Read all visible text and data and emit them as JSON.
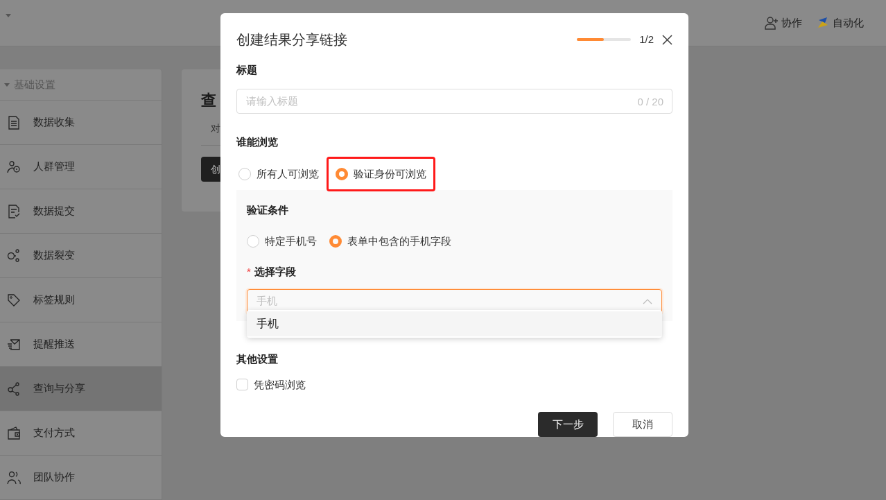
{
  "header": {
    "actions": [
      {
        "kind": "collab",
        "label": "协作"
      },
      {
        "kind": "automation",
        "label": "自动化"
      }
    ]
  },
  "sidebar": {
    "group": {
      "label": "基础设置",
      "expanded": true
    },
    "items": [
      {
        "kind": "doc",
        "label": "数据收集",
        "selected": false
      },
      {
        "kind": "people",
        "label": "人群管理",
        "selected": false
      },
      {
        "kind": "submit",
        "label": "数据提交",
        "selected": false
      },
      {
        "kind": "fission",
        "label": "数据裂变",
        "selected": false
      },
      {
        "kind": "tag",
        "label": "标签规则",
        "selected": false
      },
      {
        "kind": "mail",
        "label": "提醒推送",
        "selected": false
      },
      {
        "kind": "share",
        "label": "查询与分享",
        "selected": true
      },
      {
        "kind": "wallet",
        "label": "支付方式",
        "selected": false
      },
      {
        "kind": "team",
        "label": "团队协作",
        "selected": false
      }
    ]
  },
  "page": {
    "title": "查",
    "tab": "对",
    "button": "创"
  },
  "dialog": {
    "title": "创建结果分享链接",
    "progress": {
      "level": 0.5,
      "text": "1/2"
    },
    "title_field": {
      "label": "标题",
      "placeholder": "请输入标题",
      "counter": "0 / 20"
    },
    "audience": {
      "label": "谁能浏览",
      "options": [
        {
          "label": "所有人可浏览",
          "selected": false,
          "highlighted": false
        },
        {
          "label": "验证身份可浏览",
          "selected": true,
          "highlighted": true
        }
      ]
    },
    "verify": {
      "label": "验证条件",
      "options": [
        {
          "label": "特定手机号",
          "selected": false
        },
        {
          "label": "表单中包含的手机字段",
          "selected": true
        }
      ],
      "field": {
        "label": "选择字段",
        "required_mark": "*",
        "placeholder": "手机",
        "expanded": true,
        "options": [
          {
            "label": "手机"
          }
        ]
      }
    },
    "other": {
      "label": "其他设置",
      "options": [
        {
          "label": "凭密码浏览",
          "checked": false
        }
      ]
    },
    "buttons": [
      {
        "kind": "primary",
        "label": "下一步"
      },
      {
        "kind": "secondary",
        "label": "取消"
      }
    ]
  }
}
